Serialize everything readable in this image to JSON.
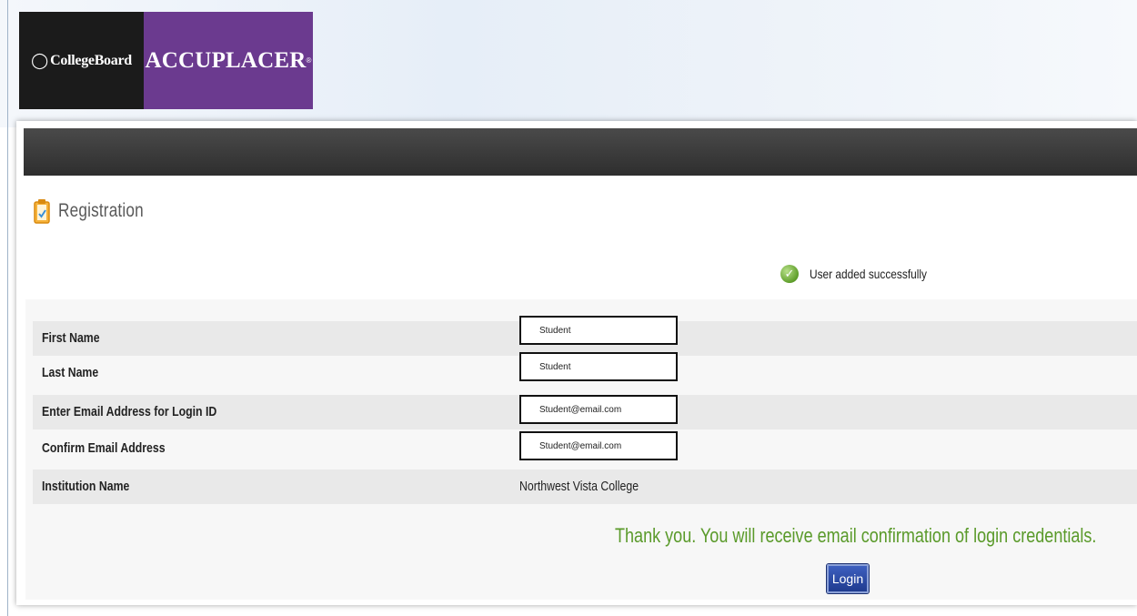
{
  "brand": {
    "collegeboard": "CollegeBoard",
    "accuplacer": "ACCUPLACER",
    "trademark": "®",
    "colors": {
      "collegeboard_bg": "#1b1b1b",
      "accuplacer_bg": "#6b3a8f"
    }
  },
  "page": {
    "title": "Registration",
    "title_icon": "clipboard-check-icon"
  },
  "status": {
    "message": "User added successfully",
    "icon": "check-circle-icon",
    "color": "#5f9e2a"
  },
  "form": {
    "first_name": {
      "label": "First Name",
      "value": "Student"
    },
    "last_name": {
      "label": "Last Name",
      "value": "Student"
    },
    "email": {
      "label": "Enter Email Address for Login ID",
      "value": "Student@email.com"
    },
    "confirm_email": {
      "label": "Confirm Email Address",
      "value": "Student@email.com"
    },
    "institution": {
      "label": "Institution Name",
      "value": "Northwest Vista College"
    }
  },
  "confirmation": {
    "message": "Thank you. You will receive email confirmation of login credentials.",
    "color": "#5a9a2a"
  },
  "actions": {
    "login_label": "Login"
  }
}
